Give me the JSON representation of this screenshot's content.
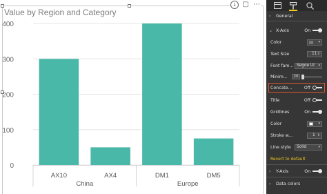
{
  "chart_title": "Value by Region and Category",
  "colors": {
    "bar": "#4ab8a8",
    "gridline": "#e6e6e6",
    "pane_bg": "#363636",
    "accent_yellow": "#f0c81e",
    "highlight": "#e05a2a"
  },
  "chart_data": {
    "type": "bar",
    "title": "Value by Region and Category",
    "categories": [
      "AX10",
      "AX4",
      "DM1",
      "DM5"
    ],
    "groups": [
      {
        "name": "China",
        "categories": [
          "AX10",
          "AX4"
        ]
      },
      {
        "name": "Europe",
        "categories": [
          "DM1",
          "DM5"
        ]
      }
    ],
    "values": [
      300,
      50,
      400,
      75
    ],
    "ylim": [
      0,
      400
    ],
    "yticks": [
      0,
      100,
      200,
      300,
      400
    ],
    "ytick_labels": [
      "0",
      "100",
      "200",
      "300",
      "400"
    ],
    "grid": true,
    "legend": "none"
  },
  "pane": {
    "tabs": [
      "fields-icon",
      "format-paint-roller-icon",
      "analytics-icon"
    ],
    "general": "General",
    "x_axis": "X-Axis",
    "x_axis_state": "On",
    "color": "Color",
    "text_size": "Text Size",
    "text_size_value": "11",
    "font_family": "Font fam...",
    "font_family_value": "Segoe UI",
    "min_height": "Minim...",
    "min_height_value": "20",
    "concatenate": "Concate...",
    "concatenate_state": "Off",
    "title": "Title",
    "title_state": "Off",
    "gridlines": "Gridlines",
    "gridlines_state": "On",
    "grid_color": "Color",
    "stroke_width": "Stroke w...",
    "stroke_width_value": "1",
    "line_style": "Line style",
    "line_style_value": "Solid",
    "revert": "Revert to default",
    "y_axis": "Y-Axis",
    "y_axis_state": "On",
    "data_colors": "Data colors"
  }
}
